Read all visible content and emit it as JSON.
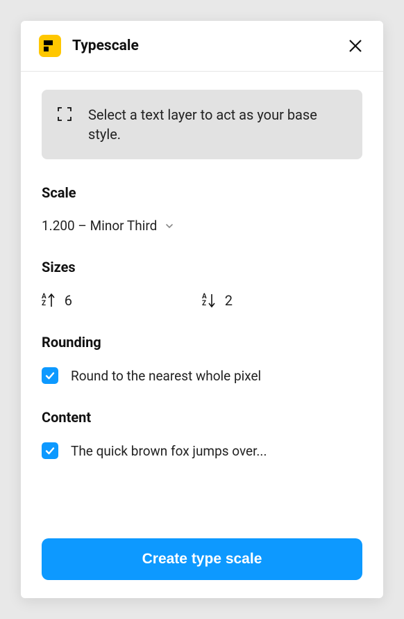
{
  "header": {
    "title": "Typescale"
  },
  "hint": {
    "text": "Select a text layer to act as your base style."
  },
  "sections": {
    "scale": {
      "heading": "Scale",
      "selected": "1.200 – Minor Third"
    },
    "sizes": {
      "heading": "Sizes",
      "up": "6",
      "down": "2"
    },
    "rounding": {
      "heading": "Rounding",
      "label": "Round to the nearest whole pixel",
      "checked": true
    },
    "content": {
      "heading": "Content",
      "label": "The quick brown fox jumps over...",
      "checked": true
    }
  },
  "button": {
    "label": "Create type scale"
  }
}
